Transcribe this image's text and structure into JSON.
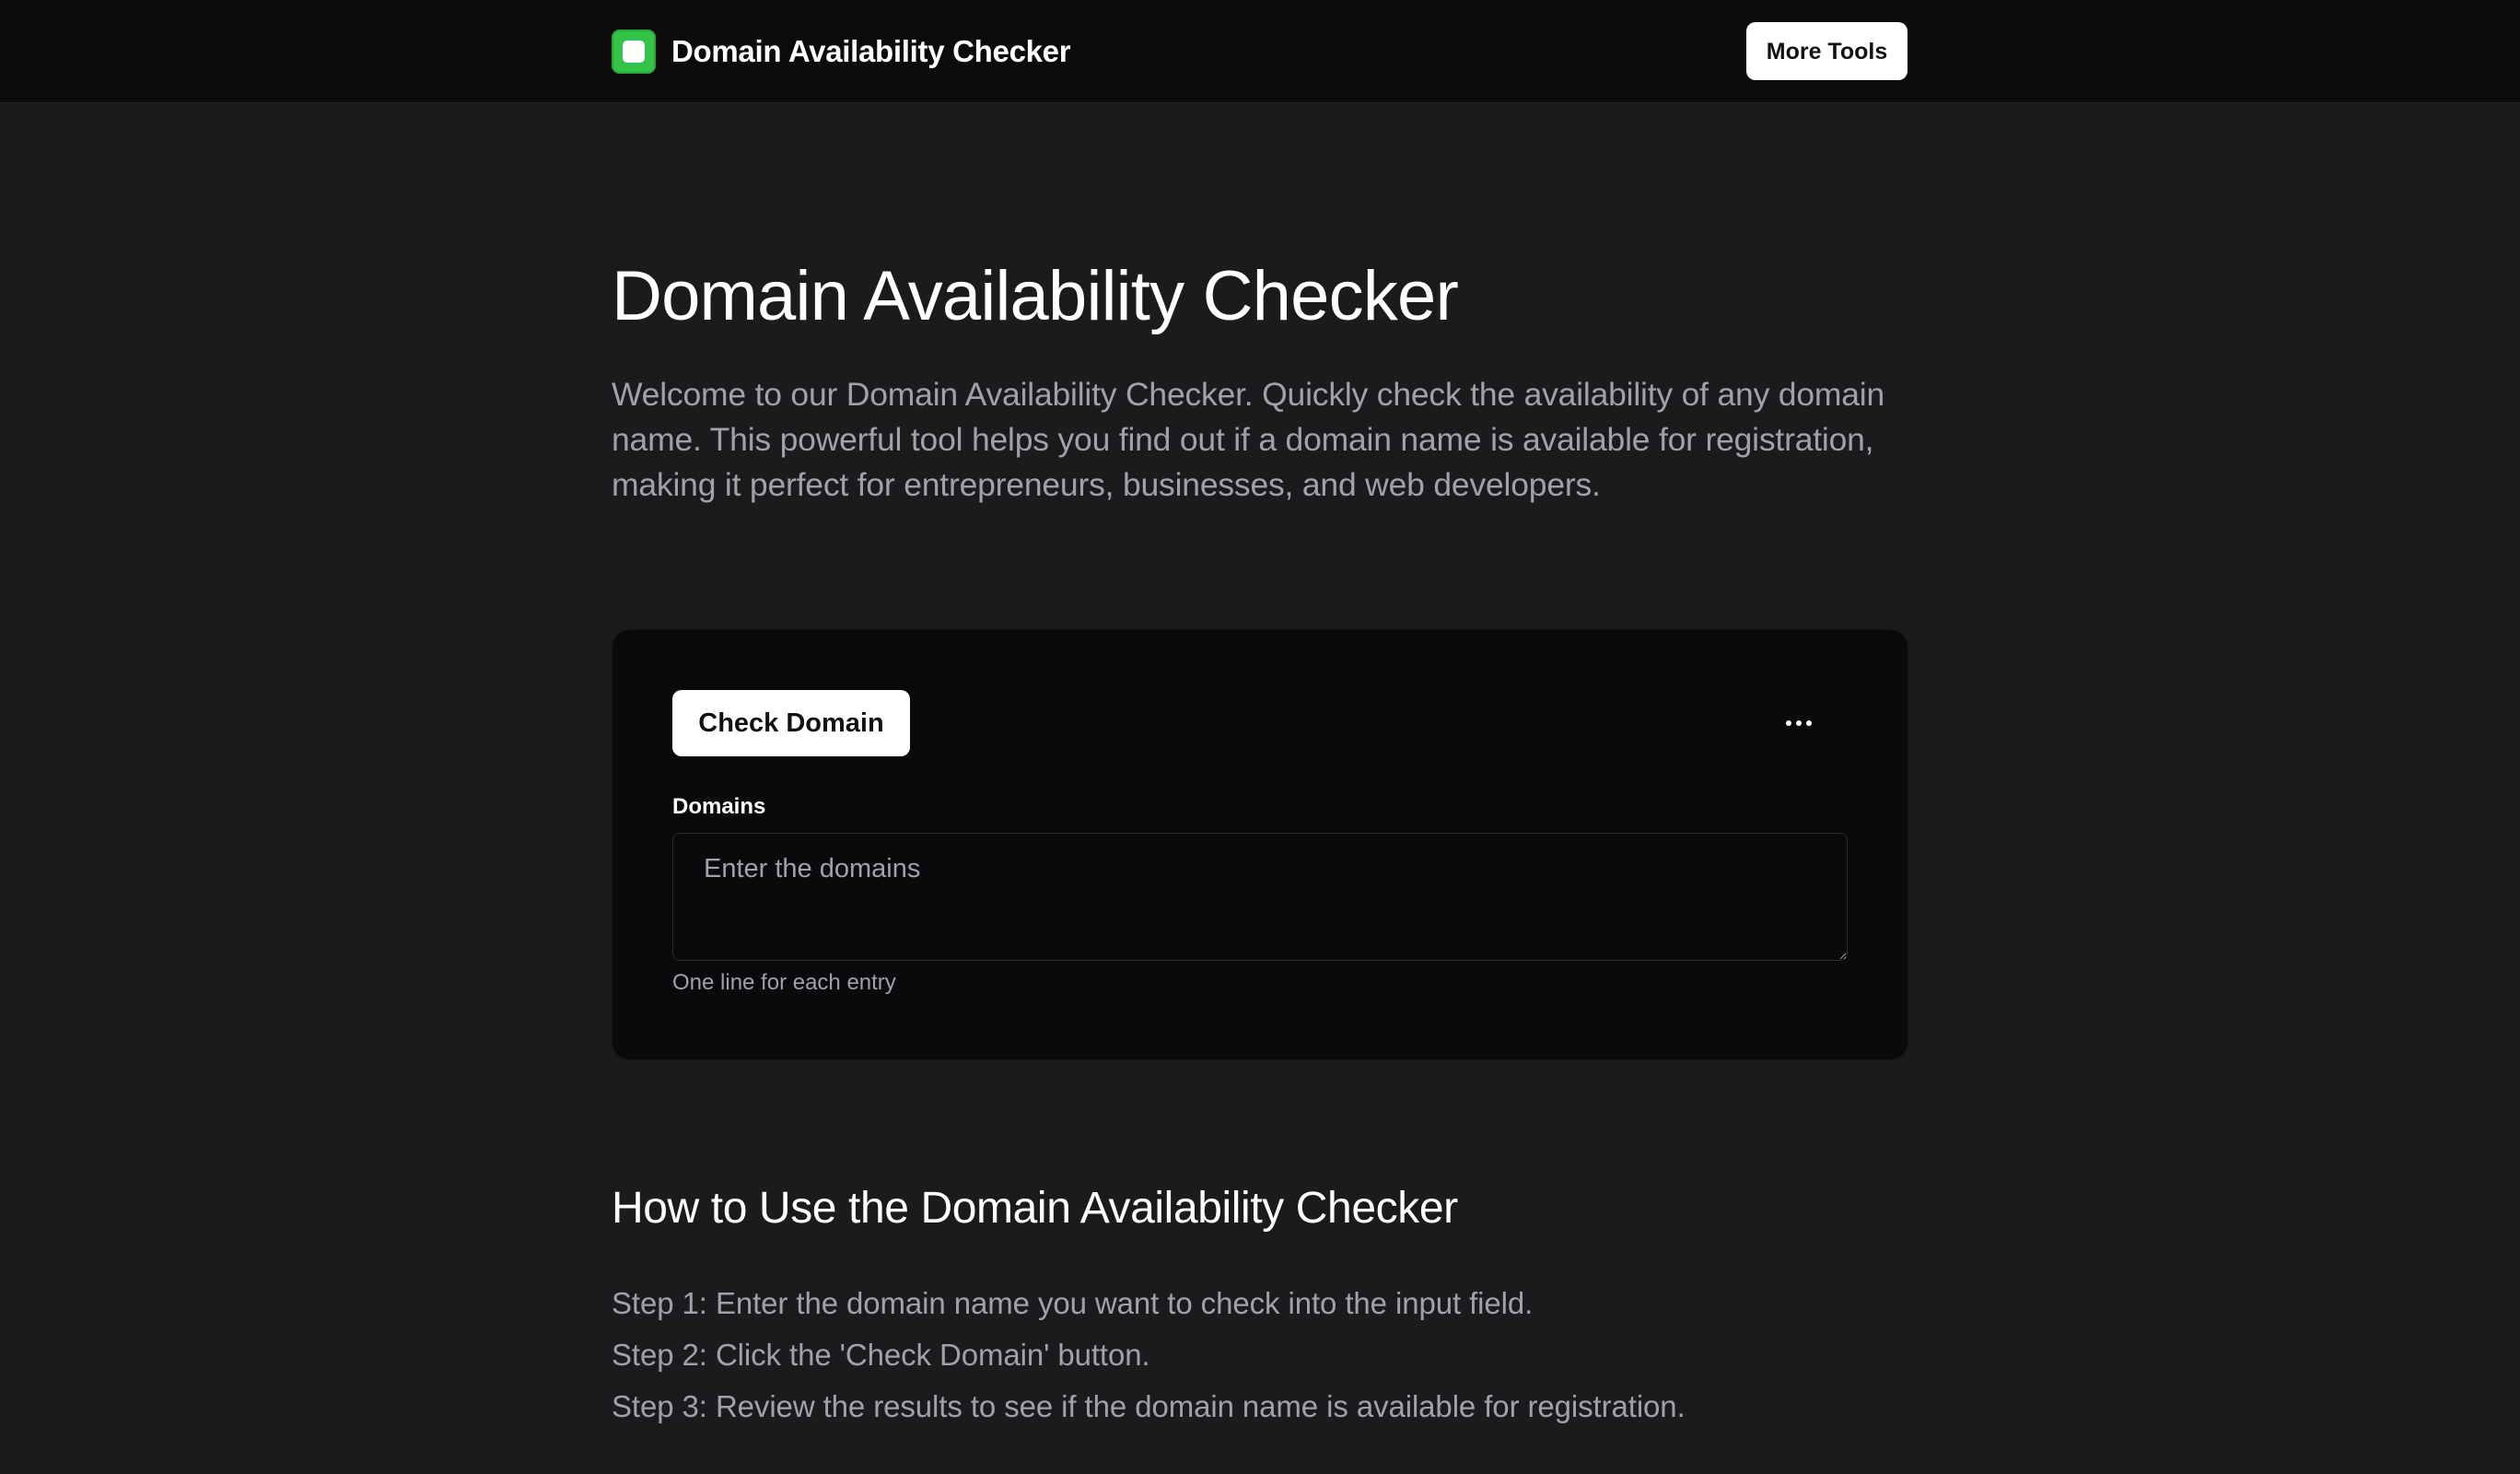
{
  "header": {
    "brand_name": "Domain Availability Checker",
    "logo_icon": "app-logo-icon",
    "more_tools_label": "More Tools"
  },
  "main": {
    "title": "Domain Availability Checker",
    "intro": "Welcome to our Domain Availability Checker. Quickly check the availability of any domain name. This powerful tool helps you find out if a domain name is available for registration, making it perfect for entrepreneurs, businesses, and web developers."
  },
  "tool": {
    "check_button_label": "Check Domain",
    "menu_icon": "more-horizontal-icon",
    "field_label": "Domains",
    "field_placeholder": "Enter the domains",
    "field_value": "",
    "field_hint": "One line for each entry"
  },
  "howto": {
    "title": "How to Use the Domain Availability Checker",
    "steps": [
      "Step 1: Enter the domain name you want to check into the input field.",
      "Step 2: Click the 'Check Domain' button.",
      "Step 3: Review the results to see if the domain name is available for registration."
    ]
  },
  "colors": {
    "page_background": "#1b1b1d",
    "header_background": "#0b0b0d",
    "card_background": "#0a0a0c",
    "brand_accent": "#35c44a",
    "muted_text": "#a1a1aa"
  }
}
